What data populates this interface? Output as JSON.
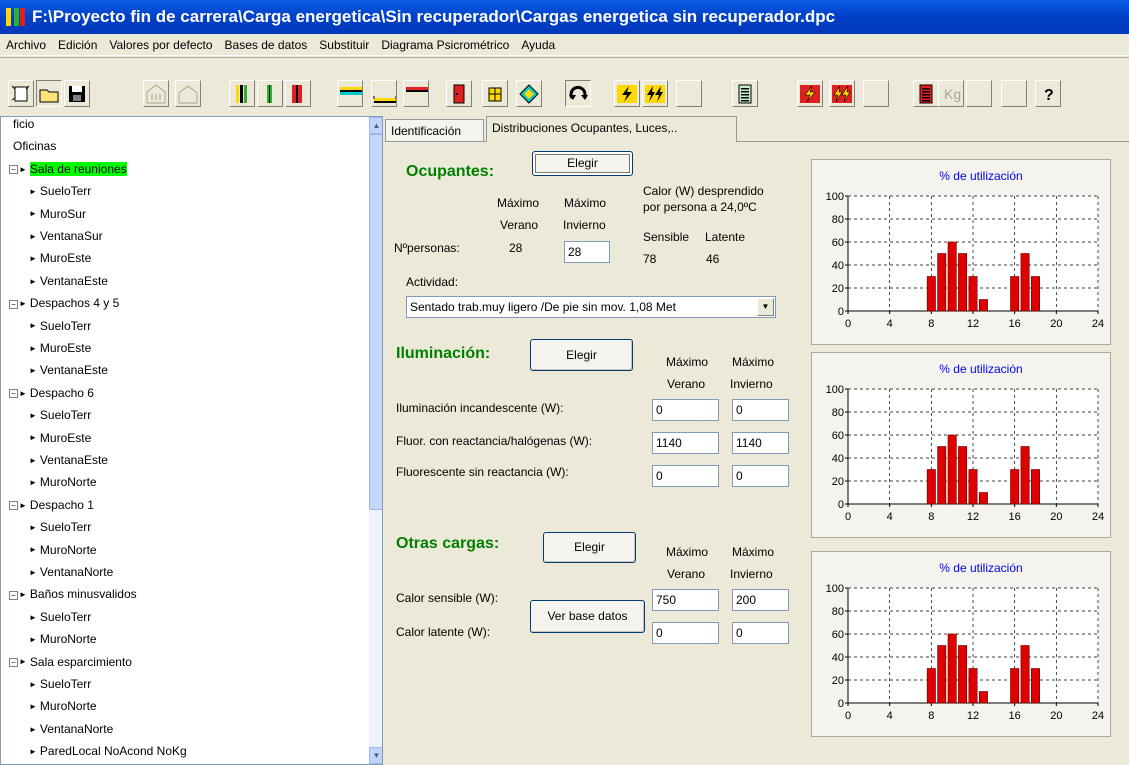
{
  "title_bar": {
    "title": "F:\\Proyecto fin de carrera\\Carga energetica\\Sin recuperador\\Cargas energetica sin recuperador.dpc"
  },
  "menu": [
    "Archivo",
    "Edición",
    "Valores por defecto",
    "Bases de datos",
    "Substituir",
    "Diagrama Psicrométrico",
    "Ayuda"
  ],
  "toolbar": {
    "kg_label": "Kg",
    "help_label": "?",
    "icons": [
      "new-icon",
      "open-icon",
      "save-icon",
      "building-icon",
      "house-icon",
      "wall-icon",
      "wall-thin-icon",
      "wall-red-icon",
      "ceiling-icon",
      "floor-icon",
      "roof-icon",
      "door-icon",
      "window-icon",
      "diamond-icon",
      "refresh-icon",
      "bolt-icon",
      "bolt-double-icon",
      "blank-icon",
      "report-icon",
      "bolt-red-icon",
      "bolt-red-double-icon",
      "blank-icon",
      "report-red-icon",
      "kg-icon",
      "blank-icon",
      "blank-icon",
      "help-icon"
    ],
    "colors": {
      "green": "#2EAF2E",
      "red": "#E02020",
      "yellow": "#FFD800",
      "cyan": "#00C8C8"
    }
  },
  "tree": {
    "items": [
      {
        "label": "ficio",
        "level": 0
      },
      {
        "label": "Oficinas",
        "level": 0
      },
      {
        "label": "Sala de reuniones",
        "level": 1,
        "selected": true
      },
      {
        "label": "SueloTerr",
        "level": 2
      },
      {
        "label": "MuroSur",
        "level": 2
      },
      {
        "label": "VentanaSur",
        "level": 2
      },
      {
        "label": "MuroEste",
        "level": 2
      },
      {
        "label": "VentanaEste",
        "level": 2
      },
      {
        "label": "Despachos 4 y 5",
        "level": 1
      },
      {
        "label": "SueloTerr",
        "level": 2
      },
      {
        "label": "MuroEste",
        "level": 2
      },
      {
        "label": "VentanaEste",
        "level": 2
      },
      {
        "label": "Despacho 6",
        "level": 1
      },
      {
        "label": "SueloTerr",
        "level": 2
      },
      {
        "label": "MuroEste",
        "level": 2
      },
      {
        "label": "VentanaEste",
        "level": 2
      },
      {
        "label": "MuroNorte",
        "level": 2
      },
      {
        "label": "Despacho 1",
        "level": 1
      },
      {
        "label": "SueloTerr",
        "level": 2
      },
      {
        "label": "MuroNorte",
        "level": 2
      },
      {
        "label": "VentanaNorte",
        "level": 2
      },
      {
        "label": "Baños minusvalidos",
        "level": 1
      },
      {
        "label": "SueloTerr",
        "level": 2
      },
      {
        "label": "MuroNorte",
        "level": 2
      },
      {
        "label": "Sala esparcimiento",
        "level": 1
      },
      {
        "label": "SueloTerr",
        "level": 2
      },
      {
        "label": "MuroNorte",
        "level": 2
      },
      {
        "label": "VentanaNorte",
        "level": 2
      },
      {
        "label": "ParedLocal NoAcond NoKg",
        "level": 2
      }
    ],
    "selected_color": "#00FF00"
  },
  "tabs": [
    "Identificación",
    "Distribuciones Ocupantes, Luces,.."
  ],
  "active_tab": 1,
  "ocupantes": {
    "title": "Ocupantes:",
    "elegir": "Elegir",
    "max_verano": "Máximo",
    "verano": "Verano",
    "max_invierno": "Máximo",
    "invierno": "Invierno",
    "npersonas_label": "Nºpersonas:",
    "npersonas_verano": "28",
    "npersonas_invierno": "28",
    "calor_line1": "Calor (W) desprendido",
    "calor_line2": "por persona a 24,0ºC",
    "sensible_label": "Sensible",
    "latente_label": "Latente",
    "sensible_value": "78",
    "latente_value": "46",
    "actividad_label": "Actividad:",
    "actividad_value": "Sentado trab.muy ligero /De pie sin mov.  1,08 Met"
  },
  "iluminacion": {
    "title": "Iluminación:",
    "elegir": "Elegir",
    "max_verano": "Máximo",
    "verano": "Verano",
    "max_invierno": "Máximo",
    "invierno": "Invierno",
    "rows": [
      {
        "label": "Iluminación incandescente (W):",
        "verano": "0",
        "invierno": "0"
      },
      {
        "label": "Fluor. con reactancia/halógenas (W):",
        "verano": "1140",
        "invierno": "1140"
      },
      {
        "label": "Fluorescente sin reactancia (W):",
        "verano": "0",
        "invierno": "0"
      }
    ]
  },
  "otras": {
    "title": "Otras cargas:",
    "elegir": "Elegir",
    "ver_base": "Ver base datos",
    "max_verano": "Máximo",
    "verano": "Verano",
    "max_invierno": "Máximo",
    "invierno": "Invierno",
    "rows": [
      {
        "label": "Calor sensible (W):",
        "verano": "750",
        "invierno": "200"
      },
      {
        "label": "Calor latente (W):",
        "verano": "0",
        "invierno": "0"
      }
    ]
  },
  "chart_data": [
    {
      "type": "bar",
      "title": "% de utilización",
      "x": [
        8,
        9,
        10,
        11,
        12,
        13,
        16,
        17,
        18
      ],
      "values": [
        30,
        50,
        60,
        50,
        30,
        10,
        30,
        50,
        30
      ],
      "xlim": [
        0,
        24
      ],
      "ylim": [
        0,
        100
      ],
      "xticks": [
        0,
        4,
        8,
        12,
        16,
        20,
        24
      ],
      "yticks": [
        0,
        20,
        40,
        60,
        80,
        100
      ],
      "grid": true,
      "bar_color": "#E00000"
    },
    {
      "type": "bar",
      "title": "% de utilización",
      "x": [
        8,
        9,
        10,
        11,
        12,
        13,
        16,
        17,
        18
      ],
      "values": [
        30,
        50,
        60,
        50,
        30,
        10,
        30,
        50,
        30
      ],
      "xlim": [
        0,
        24
      ],
      "ylim": [
        0,
        100
      ],
      "xticks": [
        0,
        4,
        8,
        12,
        16,
        20,
        24
      ],
      "yticks": [
        0,
        20,
        40,
        60,
        80,
        100
      ],
      "grid": true,
      "bar_color": "#E00000"
    },
    {
      "type": "bar",
      "title": "% de utilización",
      "x": [
        8,
        9,
        10,
        11,
        12,
        13,
        16,
        17,
        18
      ],
      "values": [
        30,
        50,
        60,
        50,
        30,
        10,
        30,
        50,
        30
      ],
      "xlim": [
        0,
        24
      ],
      "ylim": [
        0,
        100
      ],
      "xticks": [
        0,
        4,
        8,
        12,
        16,
        20,
        24
      ],
      "yticks": [
        0,
        20,
        40,
        60,
        80,
        100
      ],
      "grid": true,
      "bar_color": "#E00000"
    }
  ]
}
